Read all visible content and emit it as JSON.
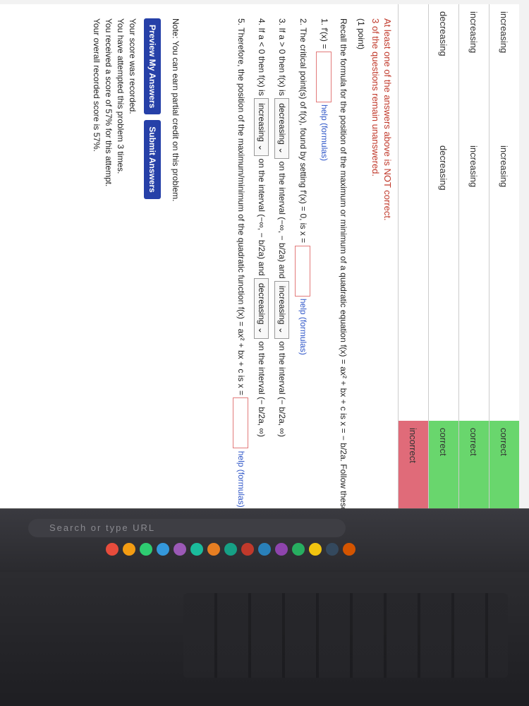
{
  "summary_rows": [
    {
      "answer": "increasing",
      "entered": "increasing",
      "status": "correct",
      "status_color": "#69d66d"
    },
    {
      "answer": "increasing",
      "entered": "increasing",
      "status": "correct",
      "status_color": "#69d66d"
    },
    {
      "answer": "decreasing",
      "entered": "decreasing",
      "status": "correct",
      "status_color": "#69d66d"
    },
    {
      "answer": "",
      "entered": "",
      "status": "incorrect",
      "status_color": "#e06b79"
    }
  ],
  "message": {
    "line1": "At least one of the answers above is NOT correct.",
    "line2": "3 of the questions remain unanswered."
  },
  "problem": {
    "points": "(1 point)",
    "intro": "Recall the formula for the position of the maximum or minimum of a quadratic equation f(x) = ax² + bx + c is x = − b/2a. Follow these steps to prove this formula using calculus.",
    "step1": "1. f′(x) =",
    "help": "help (formulas)",
    "step2": "2. The critical point(s) of f(x), found by setting f′(x) = 0, is x =",
    "step3_a": "3. If a > 0 then f(x) is",
    "step3_sel1": "decreasing",
    "step3_b": "on the interval (−∞, − b/2a) and",
    "step3_sel2": "increasing",
    "step3_c": "on the interval (− b/2a, ∞)",
    "step4_a": "4. If a < 0 then f(x) is",
    "step4_sel1": "increasing",
    "step4_b": "on the interval (−∞, − b/2a) and",
    "step4_sel2": "decreasing",
    "step4_c": "on the interval (− b/2a, ∞)",
    "step5": "5. Therefore, the position of the maximum/minimum of the quadratic function f(x) = ax² + bx + c is x ="
  },
  "note": "Note: You can earn partial credit on this problem.",
  "buttons": {
    "preview": "Preview My Answers",
    "submit": "Submit Answers"
  },
  "score": {
    "line1": "Your score was recorded.",
    "line2": "You have attempted this problem 3 times.",
    "line3": "You received a score of 57% for this attempt.",
    "line4": "Your overall recorded score is 57%."
  },
  "taskbar": {
    "search_placeholder": "Search or type URL"
  },
  "dock_colors": [
    "#e74c3c",
    "#f39c12",
    "#2ecc71",
    "#3498db",
    "#9b59b6",
    "#1abc9c",
    "#e67e22",
    "#16a085",
    "#c0392b",
    "#2980b9",
    "#8e44ad",
    "#27ae60",
    "#f1c40f",
    "#34495e",
    "#d35400"
  ]
}
